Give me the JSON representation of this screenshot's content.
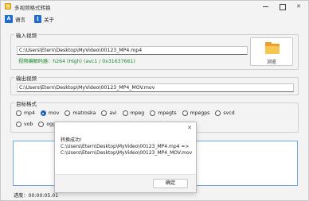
{
  "window": {
    "title": "多视频格式转换"
  },
  "menu": {
    "language_label": "语言",
    "about_label": "关于"
  },
  "input_group": {
    "title": "输入视频",
    "path": "C:\\Users\\Etern\\Desktop\\MyVideo\\00123_MP4.mp4",
    "codec_info": "视频编解码器：h264 (High) (avc1 / 0x31637661)",
    "browse_label": "浏览"
  },
  "output_group": {
    "title": "输出视频",
    "path": "C:\\Users\\Etern\\Desktop\\MyVideo\\00123_MP4_MOV.mov"
  },
  "target_group": {
    "title": "目标格式",
    "formats_row1": [
      "mp4",
      "mov",
      "matroska",
      "avi",
      "mpeg",
      "mpegts",
      "mpegps",
      "svcd"
    ],
    "formats_row2": [
      "vob",
      "ogg"
    ],
    "selected": "mov"
  },
  "progress": {
    "text": "进度：00:00:05.01"
  },
  "dialog": {
    "message_line1": "转换成功!",
    "message_line2": "C:\\Users\\Etern\\Desktop\\MyVideo\\00123_MP4.mp4 =>",
    "message_line3": "C:\\Users\\Etern\\Desktop\\MyVideo\\00123_MP4_MOV.mov",
    "ok_label": "确定",
    "close_glyph": "✕"
  },
  "colors": {
    "accent": "#1e5fb8",
    "success_text": "#1b8a2d",
    "folder": "#f7c64e"
  }
}
